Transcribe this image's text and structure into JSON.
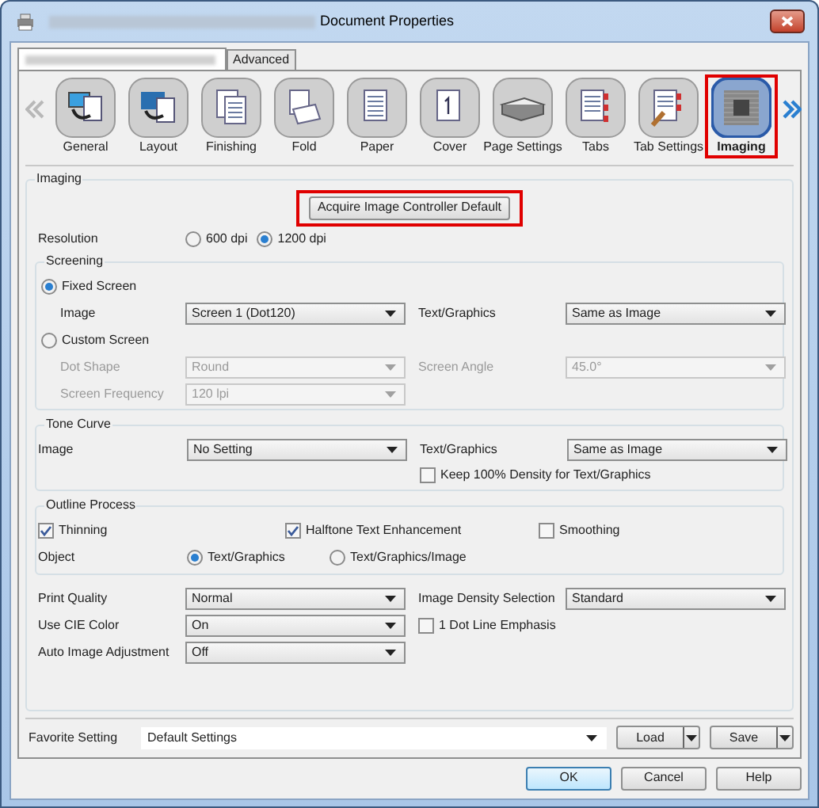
{
  "window": {
    "title": "Document Properties"
  },
  "top_tabs": [
    {
      "label": "Advanced",
      "selected": false
    }
  ],
  "categories": [
    {
      "label": "General",
      "selected": false,
      "highlighted": false
    },
    {
      "label": "Layout",
      "selected": false,
      "highlighted": false
    },
    {
      "label": "Finishing",
      "selected": false,
      "highlighted": false
    },
    {
      "label": "Fold",
      "selected": false,
      "highlighted": false
    },
    {
      "label": "Paper",
      "selected": false,
      "highlighted": false
    },
    {
      "label": "Cover",
      "selected": false,
      "highlighted": false
    },
    {
      "label": "Page Settings",
      "selected": false,
      "highlighted": false
    },
    {
      "label": "Tabs",
      "selected": false,
      "highlighted": false
    },
    {
      "label": "Tab Settings",
      "selected": false,
      "highlighted": false
    },
    {
      "label": "Imaging",
      "selected": true,
      "highlighted": true
    }
  ],
  "imaging": {
    "legend": "Imaging",
    "acquire_button": {
      "label": "Acquire Image Controller Default",
      "highlighted": true
    },
    "resolution": {
      "label": "Resolution",
      "options": [
        {
          "label": "600 dpi",
          "selected": false
        },
        {
          "label": "1200 dpi",
          "selected": true
        }
      ]
    },
    "screening": {
      "legend": "Screening",
      "fixed": {
        "label": "Fixed Screen",
        "selected": true,
        "rows": [
          {
            "label": "Image",
            "value": "Screen 1 (Dot120)",
            "label_2": "Text/Graphics",
            "value_2": "Same as Image",
            "disabled": false
          }
        ]
      },
      "custom": {
        "label": "Custom Screen",
        "selected": false,
        "rows": [
          {
            "label": "Dot Shape",
            "value": "Round",
            "label_2": "Screen Angle",
            "value_2": "45.0°",
            "disabled": true
          },
          {
            "label": "Screen Frequency",
            "value": "120 lpi",
            "disabled": true
          }
        ]
      }
    },
    "tone_curve": {
      "legend": "Tone Curve",
      "row": {
        "label": "Image",
        "value": "No Setting",
        "label_2": "Text/Graphics",
        "value_2": "Same as Image",
        "disabled": false
      },
      "keep_density": {
        "label": "Keep 100% Density for Text/Graphics",
        "checked": false
      }
    },
    "outline_process": {
      "legend": "Outline Process",
      "checks": [
        {
          "label": "Thinning",
          "checked": true
        },
        {
          "label": "Halftone Text Enhancement",
          "checked": true
        },
        {
          "label": "Smoothing",
          "checked": false
        }
      ],
      "object": {
        "label": "Object",
        "options": [
          {
            "label": "Text/Graphics",
            "selected": true
          },
          {
            "label": "Text/Graphics/Image",
            "selected": false
          }
        ]
      }
    },
    "settings": [
      {
        "label": "Print Quality",
        "value": "Normal",
        "label_2": "Image Density Selection",
        "value_2": "Standard",
        "disabled": false
      },
      {
        "label": "Use CIE Color",
        "value": "On",
        "check": {
          "label": "1 Dot Line Emphasis",
          "checked": false
        },
        "disabled": false
      },
      {
        "label": "Auto Image Adjustment",
        "value": "Off",
        "disabled": false
      }
    ]
  },
  "favorite": {
    "label": "Favorite Setting",
    "value": "Default Settings",
    "buttons": [
      "Load",
      "Save"
    ]
  },
  "footer_buttons": [
    {
      "label": "OK",
      "default": true
    },
    {
      "label": "Cancel",
      "default": false
    },
    {
      "label": "Help",
      "default": false
    }
  ]
}
